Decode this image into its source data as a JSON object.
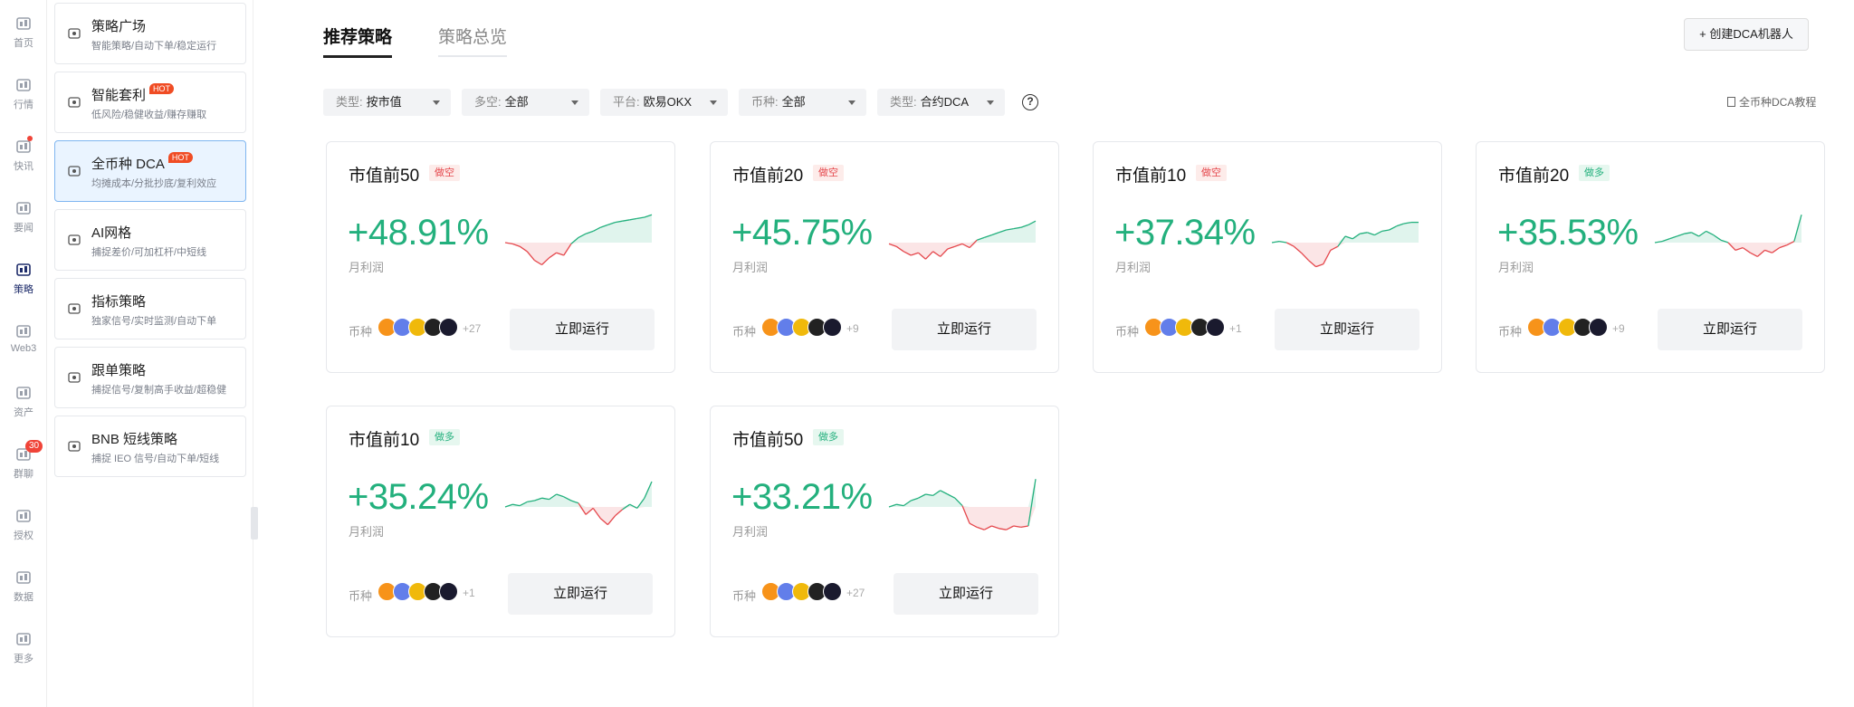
{
  "rail": [
    {
      "label": "首页",
      "icon": "home-icon"
    },
    {
      "label": "行情",
      "icon": "market-chart-icon"
    },
    {
      "label": "快讯",
      "icon": "news-flash-icon"
    },
    {
      "label": "要闻",
      "icon": "headline-doc-icon"
    },
    {
      "label": "策略",
      "icon": "robot-icon"
    },
    {
      "label": "Web3",
      "icon": "web3-icon"
    },
    {
      "label": "资产",
      "icon": "wallet-icon"
    },
    {
      "label": "群聊",
      "icon": "chat-icon",
      "badge": "30"
    },
    {
      "label": "授权",
      "icon": "auth-icon"
    },
    {
      "label": "数据",
      "icon": "data-icon"
    },
    {
      "label": "更多",
      "icon": "more-grid-icon"
    }
  ],
  "sidebar": [
    {
      "title": "策略广场",
      "subtitle": "智能策略/自动下单/稳定运行",
      "icon": "robot-icon"
    },
    {
      "title": "智能套利",
      "hot": "HOT",
      "subtitle": "低风险/稳健收益/赚存赚取",
      "icon": "arbitrage-icon"
    },
    {
      "title": "全币种 DCA",
      "hot": "HOT",
      "subtitle": "均摊成本/分批抄底/复利效应",
      "icon": "dca-icon"
    },
    {
      "title": "AI网格",
      "subtitle": "捕捉差价/可加杠杆/中短线",
      "icon": "grid-icon"
    },
    {
      "title": "指标策略",
      "subtitle": "独家信号/实时监测/自动下单",
      "icon": "indicator-icon"
    },
    {
      "title": "跟单策略",
      "subtitle": "捕捉信号/复制高手收益/超稳健",
      "icon": "copy-trade-icon"
    },
    {
      "title": "BNB 短线策略",
      "subtitle": "捕捉 IEO 信号/自动下单/短线",
      "icon": "bnb-icon"
    }
  ],
  "tabs": {
    "recommended": "推荐策略",
    "overview": "策略总览"
  },
  "create_button": "+ 创建DCA机器人",
  "filters": [
    {
      "label": "类型:",
      "value": "按市值"
    },
    {
      "label": "多空:",
      "value": "全部"
    },
    {
      "label": "平台:",
      "value": "欧易OKX"
    },
    {
      "label": "币种:",
      "value": "全部"
    },
    {
      "label": "类型:",
      "value": "合约DCA"
    }
  ],
  "help_label": "?",
  "tutorial_link": "全币种DCA教程",
  "card_labels": {
    "profit": "月利润",
    "coins": "币种",
    "run": "立即运行"
  },
  "colors": {
    "up": "#23b07d",
    "down": "#e5484d",
    "accent": "#1f2d6b"
  },
  "cards": [
    {
      "title": "市值前50",
      "tag": "做空",
      "direction": "short",
      "pct": "+48.91%",
      "more": "+27",
      "spark": [
        0.5,
        0.52,
        0.56,
        0.64,
        0.78,
        0.85,
        0.74,
        0.66,
        0.7,
        0.52,
        0.42,
        0.36,
        0.32,
        0.26,
        0.22,
        0.18,
        0.16,
        0.14,
        0.12,
        0.1,
        0.06
      ]
    },
    {
      "title": "市值前20",
      "tag": "做空",
      "direction": "short",
      "pct": "+45.75%",
      "more": "+9",
      "spark": [
        0.52,
        0.56,
        0.64,
        0.7,
        0.66,
        0.76,
        0.64,
        0.72,
        0.6,
        0.56,
        0.52,
        0.58,
        0.46,
        0.42,
        0.38,
        0.34,
        0.3,
        0.28,
        0.26,
        0.22,
        0.16
      ]
    },
    {
      "title": "市值前10",
      "tag": "做空",
      "direction": "short",
      "pct": "+37.34%",
      "more": "+1",
      "spark": [
        0.5,
        0.48,
        0.5,
        0.56,
        0.66,
        0.78,
        0.88,
        0.84,
        0.62,
        0.56,
        0.4,
        0.44,
        0.36,
        0.34,
        0.38,
        0.32,
        0.3,
        0.24,
        0.2,
        0.18,
        0.18
      ]
    },
    {
      "title": "市值前20",
      "tag": "做多",
      "direction": "long",
      "pct": "+35.53%",
      "more": "+9",
      "spark": [
        0.5,
        0.48,
        0.44,
        0.4,
        0.36,
        0.34,
        0.4,
        0.32,
        0.38,
        0.46,
        0.5,
        0.62,
        0.58,
        0.66,
        0.72,
        0.62,
        0.66,
        0.58,
        0.54,
        0.48,
        0.06
      ]
    },
    {
      "title": "市值前10",
      "tag": "做多",
      "direction": "long",
      "pct": "+35.24%",
      "more": "+1",
      "spark": [
        0.5,
        0.46,
        0.48,
        0.42,
        0.4,
        0.36,
        0.38,
        0.3,
        0.34,
        0.4,
        0.44,
        0.62,
        0.52,
        0.68,
        0.78,
        0.64,
        0.54,
        0.46,
        0.52,
        0.36,
        0.1
      ]
    },
    {
      "title": "市值前50",
      "tag": "做多",
      "direction": "long",
      "pct": "+33.21%",
      "more": "+27",
      "spark": [
        0.5,
        0.46,
        0.48,
        0.4,
        0.36,
        0.3,
        0.32,
        0.24,
        0.3,
        0.36,
        0.48,
        0.76,
        0.82,
        0.86,
        0.8,
        0.84,
        0.86,
        0.8,
        0.82,
        0.8,
        0.06
      ]
    }
  ]
}
